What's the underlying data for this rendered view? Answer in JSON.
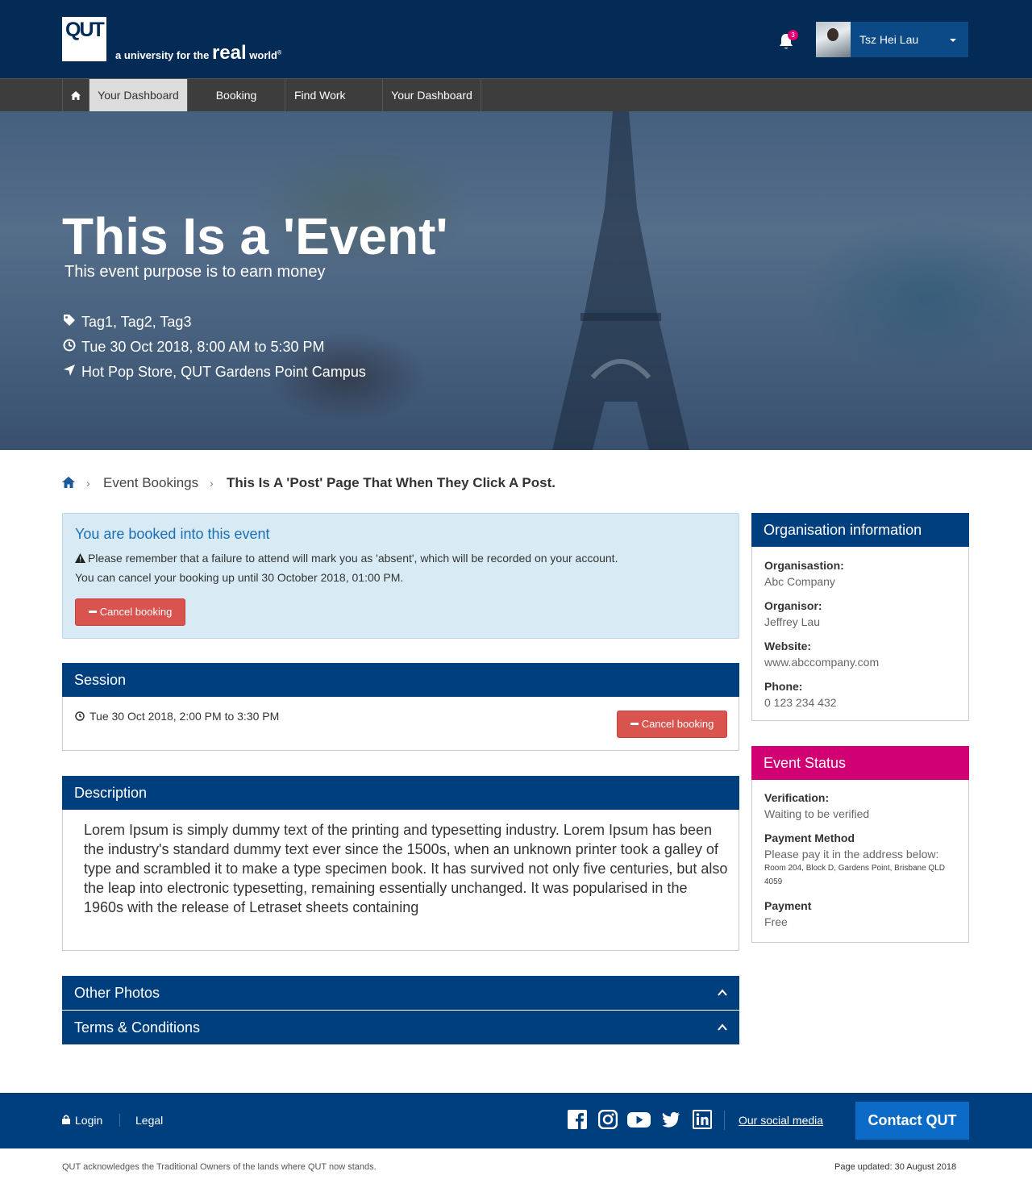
{
  "header": {
    "logo_text": "QUT",
    "tagline_prefix": "a university for the",
    "tagline_real": "real",
    "tagline_world": "world",
    "tagline_mark": "®",
    "notification_count": "3",
    "user_name": "Tsz Hei Lau"
  },
  "nav": {
    "items": [
      {
        "label": "Your Dashboard",
        "active": true
      },
      {
        "label": "Booking"
      },
      {
        "label": "Find Work"
      },
      {
        "label": "Your Dashboard"
      }
    ]
  },
  "hero": {
    "title": "This Is a 'Event'",
    "subtitle": "This event purpose is to earn money",
    "tags": "Tag1, Tag2, Tag3",
    "datetime": "Tue 30 Oct 2018, 8:00 AM to 5:30 PM",
    "location": "Hot Pop Store, QUT Gardens Point Campus"
  },
  "breadcrumb": {
    "sep": "›",
    "link": "Event Bookings",
    "current": "This Is A 'Post' Page That When They Click A Post."
  },
  "alert": {
    "title": "You are booked into this event",
    "warning": "Please remember that a failure to attend will mark you as 'absent', which will be recorded on your account.",
    "cancel_note": "You can cancel your booking up until 30 October 2018, 01:00 PM.",
    "button": "Cancel booking"
  },
  "session": {
    "heading": "Session",
    "time": "Tue 30 Oct 2018, 2:00 PM to 3:30 PM",
    "button": "Cancel booking"
  },
  "description": {
    "heading": "Description",
    "text": "Lorem Ipsum is simply dummy text of the printing and typesetting industry. Lorem Ipsum has been the industry's standard dummy text ever since the 1500s, when an unknown printer took a galley of type and scrambled it to make a type specimen book. It has survived not only five centuries, but also the leap into electronic typesetting, remaining essentially unchanged. It was popularised in the 1960s with the release of Letraset sheets containing"
  },
  "collapsibles": {
    "photos": "Other Photos",
    "terms": "Terms & Conditions"
  },
  "organisation": {
    "heading": "Organisation information",
    "org_label": "Organisastion:",
    "org_value": "Abc Company",
    "organisor_label": "Organisor:",
    "organisor_value": "Jeffrey Lau",
    "website_label": "Website:",
    "website_value": "www.abccompany.com",
    "phone_label": "Phone:",
    "phone_value": "0 123 234 432"
  },
  "status": {
    "heading": "Event Status",
    "verification_label": "Verification:",
    "verification_value": "Waiting to be verified",
    "method_label": "Payment Method",
    "method_value": "Please pay it in the address below:",
    "address": "Room 204, Block D, Gardens Point, Brisbane QLD 4059",
    "payment_label": "Payment",
    "payment_value": "Free"
  },
  "footer": {
    "login": "Login",
    "legal": "Legal",
    "social_link": "Our social media",
    "contact": "Contact QUT",
    "acknowledgement": "QUT acknowledges the Traditional Owners of the lands where QUT now stands.",
    "updated": "Page updated: 30 August 2018"
  },
  "colors": {
    "brand_navy": "#032b55",
    "panel_blue": "#003f7d",
    "status_pink": "#d10073",
    "danger": "#d9534f",
    "contact_blue": "#0c6bc6"
  },
  "icons": [
    "home-icon",
    "bell-icon",
    "chevron-down-icon",
    "tag-icon",
    "clock-icon",
    "location-arrow-icon",
    "warning-icon",
    "minus-icon",
    "chevron-up-icon",
    "lock-icon",
    "facebook-icon",
    "instagram-icon",
    "youtube-icon",
    "twitter-icon",
    "linkedin-icon"
  ]
}
